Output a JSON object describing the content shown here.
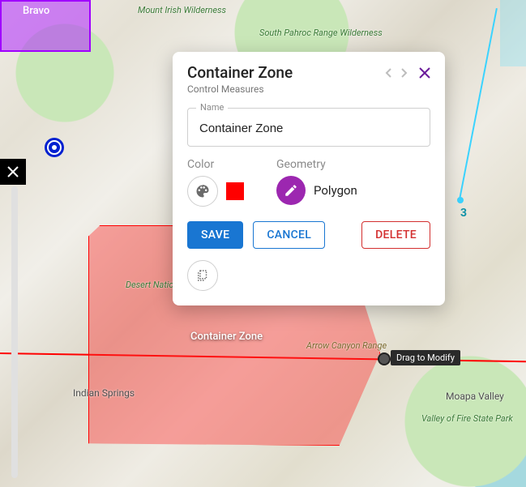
{
  "map": {
    "zonePurpleLabel": "Bravo",
    "zoneRedLabel": "Container Zone",
    "labels": {
      "mtIrish": "Mount Irish Wilderness",
      "pahroc": "South Pahroc Range Wilderness",
      "desertWildlife": "Desert National Wildlife…",
      "arrowCanyon": "Arrow Canyon Range",
      "indianSprings": "Indian Springs",
      "moapa": "Moapa Valley",
      "valleyFire": "Valley of Fire State Park"
    },
    "cyanNumber": "3",
    "modifyTip": "Drag to Modify"
  },
  "popup": {
    "title": "Container Zone",
    "subtitle": "Control Measures",
    "nameField": {
      "label": "Name",
      "value": "Container Zone"
    },
    "color": {
      "label": "Color",
      "swatchHex": "#ff0000"
    },
    "geometry": {
      "label": "Geometry",
      "value": "Polygon"
    },
    "buttons": {
      "save": "SAVE",
      "cancel": "CANCEL",
      "delete": "DELETE"
    }
  }
}
